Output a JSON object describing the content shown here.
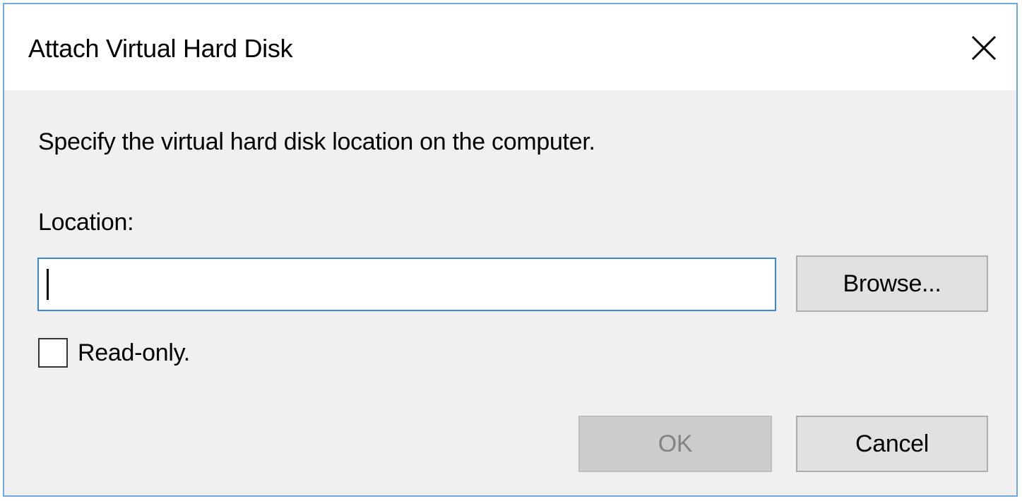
{
  "dialog": {
    "title": "Attach Virtual Hard Disk",
    "close_icon": "close-icon",
    "instruction": "Specify the virtual hard disk location on the computer.",
    "location_label": "Location:",
    "location_value": "",
    "location_placeholder": "",
    "browse_label": "Browse...",
    "readonly_label": "Read-only.",
    "readonly_checked": false,
    "ok_label": "OK",
    "ok_enabled": false,
    "cancel_label": "Cancel"
  },
  "colors": {
    "border_accent": "#6ea8dc",
    "input_focus_border": "#3d86d6",
    "dialog_background": "#f0f0f0",
    "button_background": "#e1e1e1",
    "disabled_button_background": "#cccccc"
  }
}
